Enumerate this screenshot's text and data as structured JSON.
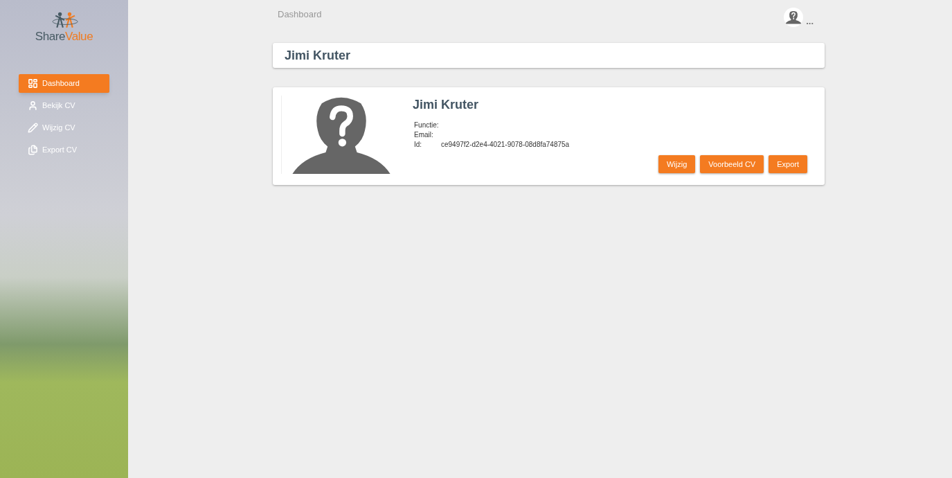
{
  "logo": {
    "part_1": "Share",
    "part_2": "Value"
  },
  "sidebar": {
    "items": [
      {
        "label": "Dashboard",
        "selected": true
      },
      {
        "label": "Bekijk CV",
        "selected": false
      },
      {
        "label": "Wijzig CV",
        "selected": false
      },
      {
        "label": "Export CV",
        "selected": false
      }
    ]
  },
  "breadcrumb": "Dashboard",
  "user_menu": {
    "more": "..."
  },
  "header": {
    "title": "Jimi Kruter"
  },
  "profile": {
    "name": "Jimi Kruter",
    "fields": [
      {
        "label": "Functie:"
      },
      {
        "label": "Email:"
      },
      {
        "label": "Id:",
        "value": "ce9497f2-d2e4-4021-9078-08d8fa74875a"
      }
    ],
    "buttons": [
      "Wijzig",
      "Voorbeeld CV",
      "Export"
    ]
  }
}
